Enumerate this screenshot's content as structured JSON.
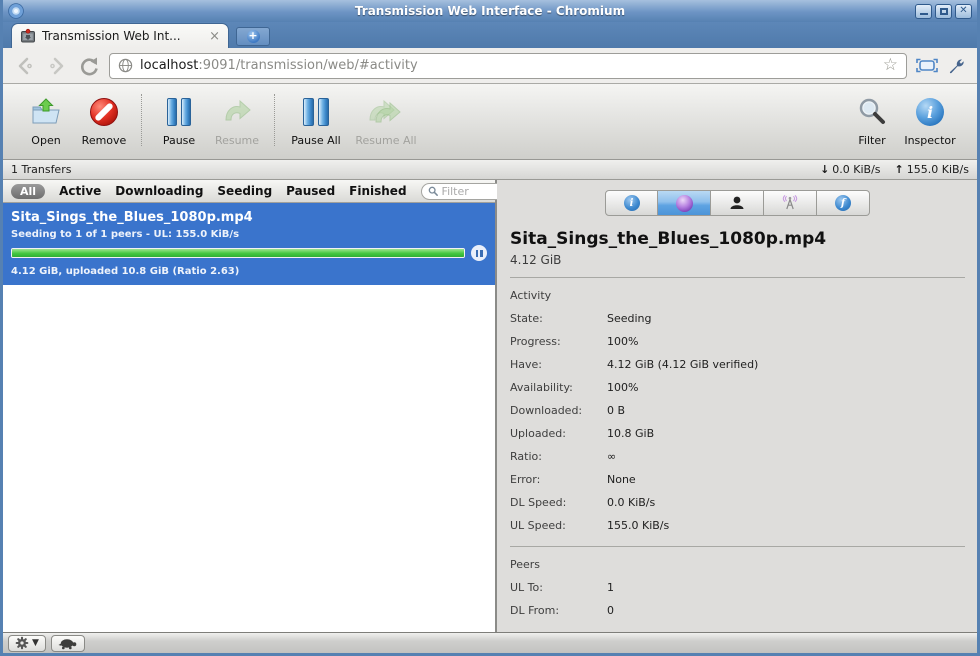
{
  "titlebar": {
    "title": "Transmission Web Interface - Chromium"
  },
  "browser": {
    "tab_title": "Transmission Web Int...",
    "tab_close": "×",
    "url_host": "localhost",
    "url_path": ":9091/transmission/web/#activity",
    "star": "☆"
  },
  "toolbar": {
    "open": "Open",
    "remove": "Remove",
    "pause": "Pause",
    "resume": "Resume",
    "pause_all": "Pause All",
    "resume_all": "Resume All",
    "filter": "Filter",
    "inspector": "Inspector",
    "inspector_glyph": "i"
  },
  "statusbar": {
    "transfers": "1 Transfers",
    "down_arrow": "↓",
    "down_speed": "0.0 KiB/s",
    "up_arrow": "↑",
    "up_speed": "155.0 KiB/s"
  },
  "filterbar": {
    "tabs": [
      {
        "label": "All"
      },
      {
        "label": "Active"
      },
      {
        "label": "Downloading"
      },
      {
        "label": "Seeding"
      },
      {
        "label": "Paused"
      },
      {
        "label": "Finished"
      }
    ],
    "search_placeholder": "Filter"
  },
  "torrent": {
    "name": "Sita_Sings_the_Blues_1080p.mp4",
    "status_line": "Seeding to 1 of 1 peers - UL: 155.0 KiB/s",
    "progress_percent": 100,
    "details_line": "4.12 GiB, uploaded 10.8 GiB (Ratio 2.63)"
  },
  "inspector": {
    "info_glyph": "i",
    "files_glyph": "f",
    "title": "Sita_Sings_the_Blues_1080p.mp4",
    "size": "4.12 GiB",
    "activity": {
      "heading": "Activity",
      "rows": [
        {
          "label": "State:",
          "value": "Seeding"
        },
        {
          "label": "Progress:",
          "value": "100%"
        },
        {
          "label": "Have:",
          "value": "4.12 GiB (4.12 GiB verified)"
        },
        {
          "label": "Availability:",
          "value": "100%"
        },
        {
          "label": "Downloaded:",
          "value": "0 B"
        },
        {
          "label": "Uploaded:",
          "value": "10.8 GiB"
        },
        {
          "label": "Ratio:",
          "value": "∞"
        },
        {
          "label": "Error:",
          "value": "None"
        },
        {
          "label": "DL Speed:",
          "value": "0.0 KiB/s"
        },
        {
          "label": "UL Speed:",
          "value": "155.0 KiB/s"
        }
      ]
    },
    "peers": {
      "heading": "Peers",
      "rows": [
        {
          "label": "UL To:",
          "value": "1"
        },
        {
          "label": "DL From:",
          "value": "0"
        }
      ]
    }
  },
  "colors": {
    "selection_blue": "#3a74cc",
    "progress_green": "#44c740",
    "frame_blue": "#5681b2",
    "selected_tab_blue": "#5ea3e2"
  }
}
